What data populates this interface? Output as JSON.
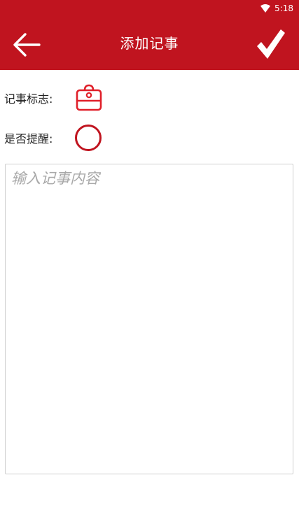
{
  "status_bar": {
    "time": "5:18",
    "icon": "wifi-icon"
  },
  "header": {
    "title": "添加记事",
    "back_icon": "arrow-left-icon",
    "save_icon": "checkmark-icon",
    "background_color": "#c0141f"
  },
  "form": {
    "mark_label": "记事标志:",
    "mark_icon": "bag-icon",
    "remind_label": "是否提醒:",
    "remind_checked": false,
    "accent_color": "#e0202a",
    "content_value": "",
    "content_placeholder": "输入记事内容"
  }
}
